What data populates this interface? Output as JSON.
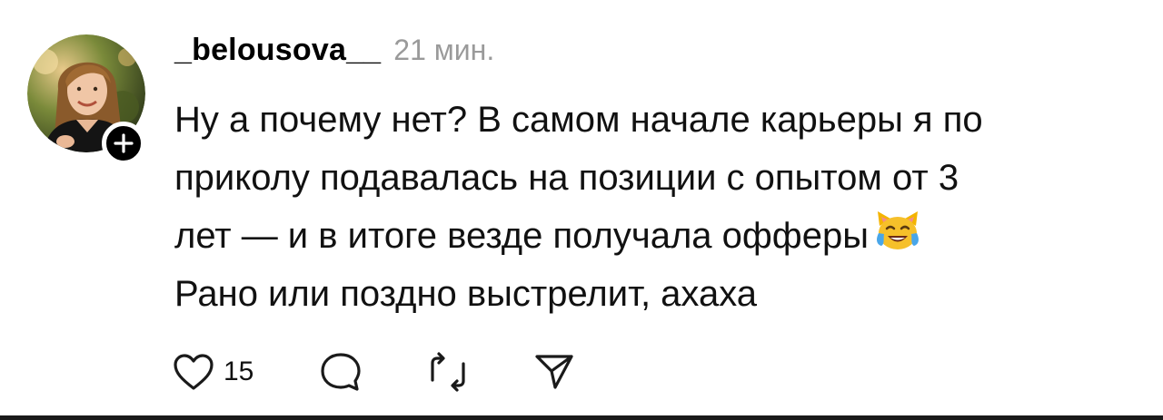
{
  "post": {
    "author": {
      "username": "_belousova__",
      "avatar_icon": "profile-photo",
      "follow_icon": "plus-icon"
    },
    "timestamp": "21 мин.",
    "text_lines": [
      "Ну а почему нет? В самом начале карьеры я по",
      "приколу подавалась на позиции с опытом от 3",
      "лет — и в итоге везде получала офферы",
      "Рано или поздно выстрелит, ахаха"
    ],
    "emoji": "cat-tears-of-joy",
    "actions": {
      "like_icon": "heart-icon",
      "like_count": "15",
      "reply_icon": "comment-icon",
      "repost_icon": "repost-icon",
      "share_icon": "send-icon"
    }
  },
  "colors": {
    "text": "#111111",
    "muted": "#9a9a9a",
    "badge": "#000000"
  }
}
